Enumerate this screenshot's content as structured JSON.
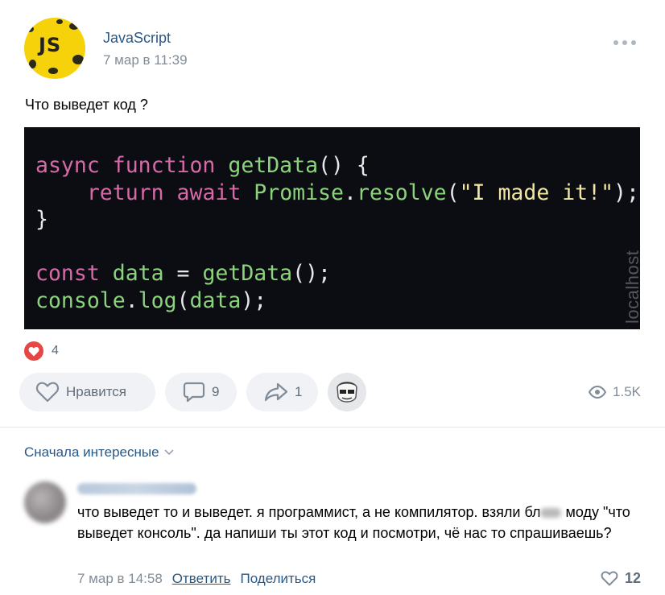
{
  "post": {
    "author": "JavaScript",
    "avatar_text": "JS",
    "date": "7 мар в 11:39",
    "text": "Что выведет код ?",
    "more_icon": "more-horizontal-icon",
    "code_lines": [
      "async function getData() {",
      "    return await Promise.resolve(\"I made it!\");",
      "}",
      "",
      "const data = getData();",
      "console.log(data);"
    ],
    "watermark": "localhost"
  },
  "reactions": {
    "icon": "heart-icon",
    "color": "#e64646",
    "count": "4"
  },
  "actions": {
    "like_label": "Нравится",
    "comments_count": "9",
    "shares_count": "1",
    "views": "1.5K"
  },
  "comments": {
    "sort_label": "Сначала интересные",
    "items": [
      {
        "text_part1": "что выведет то и выведет. я программист, а не компилятор. взяли бл",
        "text_part2": "моду \"что выведет консоль\". да напиши ты этот код и посмотри, чё нас то спрашиваешь?",
        "date": "7 мар в 14:58",
        "reply_label": "Ответить",
        "share_label": "Поделиться",
        "likes": "12"
      }
    ]
  },
  "colors": {
    "link": "#2a5885",
    "muted": "#818c99",
    "button_bg": "#f0f2f5",
    "code_bg": "#0c0d12",
    "keyword": "#d66aa8",
    "function": "#8bd37c",
    "string": "#f2e7a0"
  }
}
